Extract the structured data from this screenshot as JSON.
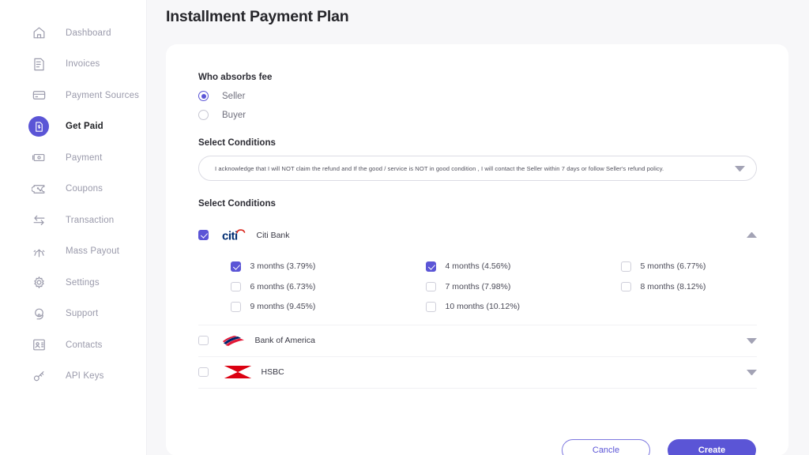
{
  "sidebar": {
    "items": [
      {
        "label": "Dashboard",
        "icon": "home-icon",
        "active": false
      },
      {
        "label": "Invoices",
        "icon": "invoice-icon",
        "active": false
      },
      {
        "label": "Payment Sources",
        "icon": "credit-card-icon",
        "active": false
      },
      {
        "label": "Get Paid",
        "icon": "get-paid-icon",
        "active": true
      },
      {
        "label": "Payment",
        "icon": "banknote-icon",
        "active": false
      },
      {
        "label": "Coupons",
        "icon": "coupon-icon",
        "active": false
      },
      {
        "label": "Transaction",
        "icon": "transfer-arrows-icon",
        "active": false
      },
      {
        "label": "Mass Payout",
        "icon": "mass-payout-icon",
        "active": false
      },
      {
        "label": "Settings",
        "icon": "gear-icon",
        "active": false
      },
      {
        "label": "Support",
        "icon": "support-icon",
        "active": false
      },
      {
        "label": "Contacts",
        "icon": "contacts-icon",
        "active": false
      },
      {
        "label": "API  Keys",
        "icon": "key-icon",
        "active": false
      }
    ]
  },
  "header": {
    "title": "Installment Payment Plan"
  },
  "form": {
    "fee_section": {
      "label": "Who absorbs fee",
      "options": [
        {
          "label": "Seller",
          "selected": true
        },
        {
          "label": "Buyer",
          "selected": false
        }
      ]
    },
    "conditions_section": {
      "label": "Select Conditions",
      "selected_value": "I acknowledge that I will NOT claim the refund and If the good / service is NOT in good condition , I will contact the Seller within 7 days or follow Seller's refund policy.",
      "caret": "chevron-down-icon"
    },
    "banks_section": {
      "label": "Select Conditions",
      "banks": [
        {
          "name": "Citi Bank",
          "logo": "citi-logo",
          "checked": true,
          "expanded": true,
          "caret": "chevron-up-icon",
          "months": [
            {
              "label": "3 months (3.79%)",
              "checked": true
            },
            {
              "label": "4 months (4.56%)",
              "checked": true
            },
            {
              "label": "5 months (6.77%)",
              "checked": false
            },
            {
              "label": "6 months (6.73%)",
              "checked": false
            },
            {
              "label": "7 months (7.98%)",
              "checked": false
            },
            {
              "label": "8 months (8.12%)",
              "checked": false
            },
            {
              "label": "9 months (9.45%)",
              "checked": false
            },
            {
              "label": "10 months (10.12%)",
              "checked": false
            }
          ]
        },
        {
          "name": "Bank of America",
          "logo": "bank-of-america-logo",
          "checked": false,
          "expanded": false,
          "caret": "chevron-down-icon",
          "months": []
        },
        {
          "name": "HSBC",
          "logo": "hsbc-logo",
          "checked": false,
          "expanded": false,
          "caret": "chevron-down-icon",
          "months": []
        }
      ]
    },
    "actions": {
      "cancel_label": "Cancle",
      "create_label": "Create"
    }
  },
  "colors": {
    "accent": "#5b55d6",
    "page_bg": "#f7f7f9",
    "card_bg": "#ffffff",
    "muted_text": "#9a9aab",
    "citi_red": "#d9261c",
    "citi_navy": "#002d72",
    "boa_red": "#e31837",
    "boa_navy": "#012169",
    "hsbc_red": "#db0011"
  }
}
